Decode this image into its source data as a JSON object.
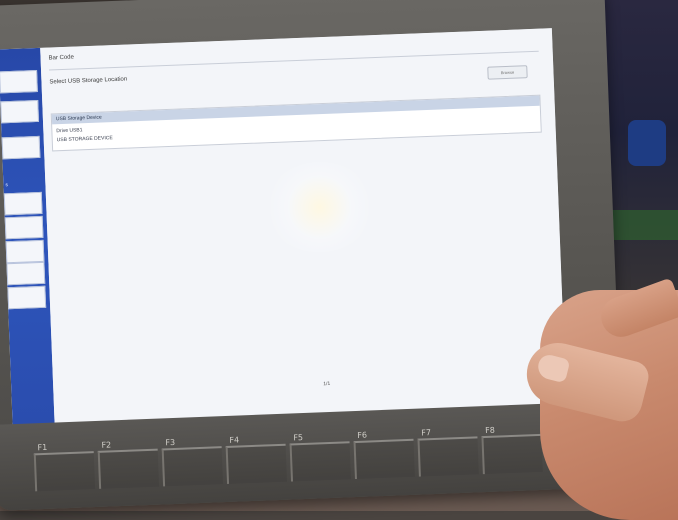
{
  "screen": {
    "section_header": "Bar Code",
    "section_subtitle": "Select USB Storage Location",
    "action_button_label": "Browse",
    "list_header": "USB Storage Device",
    "list_rows": [
      "Drive USB1",
      "USB STORAGE DEVICE"
    ],
    "page_indicator": "1/1",
    "nav_items": [
      "",
      "",
      "",
      "",
      "",
      "",
      "",
      "",
      ""
    ],
    "nav_group_label": "s"
  },
  "bezel": {
    "function_keys": [
      "F1",
      "F2",
      "F3",
      "F4",
      "F5",
      "F6",
      "F7",
      "F8"
    ]
  },
  "colors": {
    "nav_blue": "#2a4cad",
    "screen_bg": "#f3f5f9",
    "bezel": "#565450"
  }
}
